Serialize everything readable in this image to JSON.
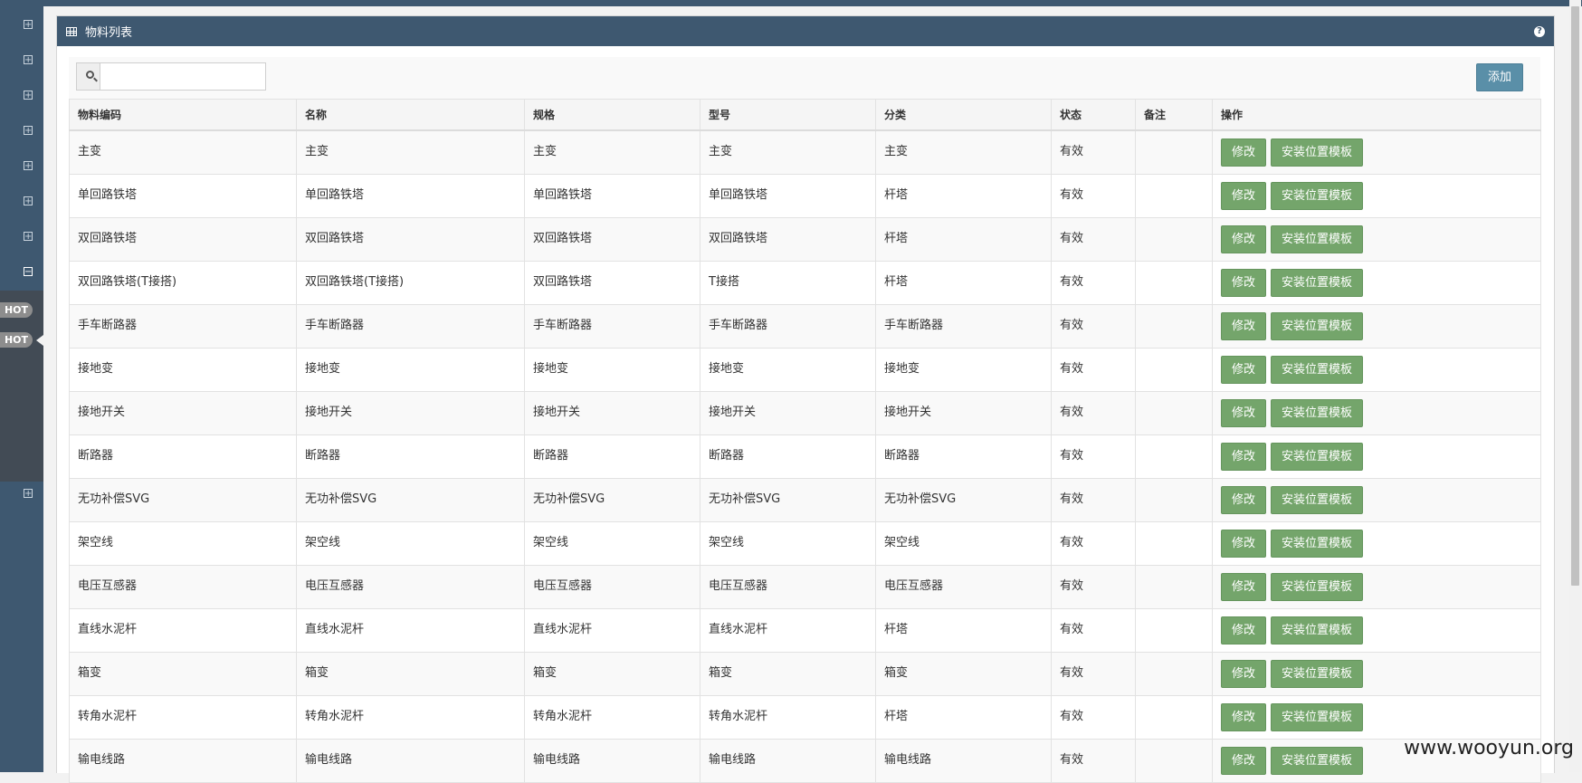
{
  "sidebar": {
    "hot_badges": [
      "HOT",
      "HOT"
    ],
    "icons": [
      "expand-icon",
      "expand-icon",
      "expand-icon",
      "expand-icon",
      "expand-icon",
      "expand-icon",
      "expand-icon",
      "collapse-icon",
      "expand-icon"
    ]
  },
  "panel": {
    "title": "物料列表",
    "help": "?"
  },
  "toolbar": {
    "search_placeholder": "",
    "add_label": "添加"
  },
  "table": {
    "columns": [
      "物料编码",
      "名称",
      "规格",
      "型号",
      "分类",
      "状态",
      "备注",
      "操作"
    ],
    "rows": [
      [
        "主变",
        "主变",
        "主变",
        "主变",
        "主变",
        "有效",
        ""
      ],
      [
        "单回路铁塔",
        "单回路铁塔",
        "单回路铁塔",
        "单回路铁塔",
        "杆塔",
        "有效",
        ""
      ],
      [
        "双回路铁塔",
        "双回路铁塔",
        "双回路铁塔",
        "双回路铁塔",
        "杆塔",
        "有效",
        ""
      ],
      [
        "双回路铁塔(T接搭)",
        "双回路铁塔(T接搭)",
        "双回路铁塔",
        "T接搭",
        "杆塔",
        "有效",
        ""
      ],
      [
        "手车断路器",
        "手车断路器",
        "手车断路器",
        "手车断路器",
        "手车断路器",
        "有效",
        ""
      ],
      [
        "接地变",
        "接地变",
        "接地变",
        "接地变",
        "接地变",
        "有效",
        ""
      ],
      [
        "接地开关",
        "接地开关",
        "接地开关",
        "接地开关",
        "接地开关",
        "有效",
        ""
      ],
      [
        "断路器",
        "断路器",
        "断路器",
        "断路器",
        "断路器",
        "有效",
        ""
      ],
      [
        "无功补偿SVG",
        "无功补偿SVG",
        "无功补偿SVG",
        "无功补偿SVG",
        "无功补偿SVG",
        "有效",
        ""
      ],
      [
        "架空线",
        "架空线",
        "架空线",
        "架空线",
        "架空线",
        "有效",
        ""
      ],
      [
        "电压互感器",
        "电压互感器",
        "电压互感器",
        "电压互感器",
        "电压互感器",
        "有效",
        ""
      ],
      [
        "直线水泥杆",
        "直线水泥杆",
        "直线水泥杆",
        "直线水泥杆",
        "杆塔",
        "有效",
        ""
      ],
      [
        "箱变",
        "箱变",
        "箱变",
        "箱变",
        "箱变",
        "有效",
        ""
      ],
      [
        "转角水泥杆",
        "转角水泥杆",
        "转角水泥杆",
        "转角水泥杆",
        "杆塔",
        "有效",
        ""
      ],
      [
        "输电线路",
        "输电线路",
        "输电线路",
        "输电线路",
        "输电线路",
        "有效",
        ""
      ]
    ],
    "edit_label": "修改",
    "template_label": "安装位置模板"
  },
  "watermark": "www.wooyun.org",
  "colors": {
    "header_bg": "#3e5870",
    "button_green": "#74a56b",
    "add_button": "#5a8fa8"
  }
}
